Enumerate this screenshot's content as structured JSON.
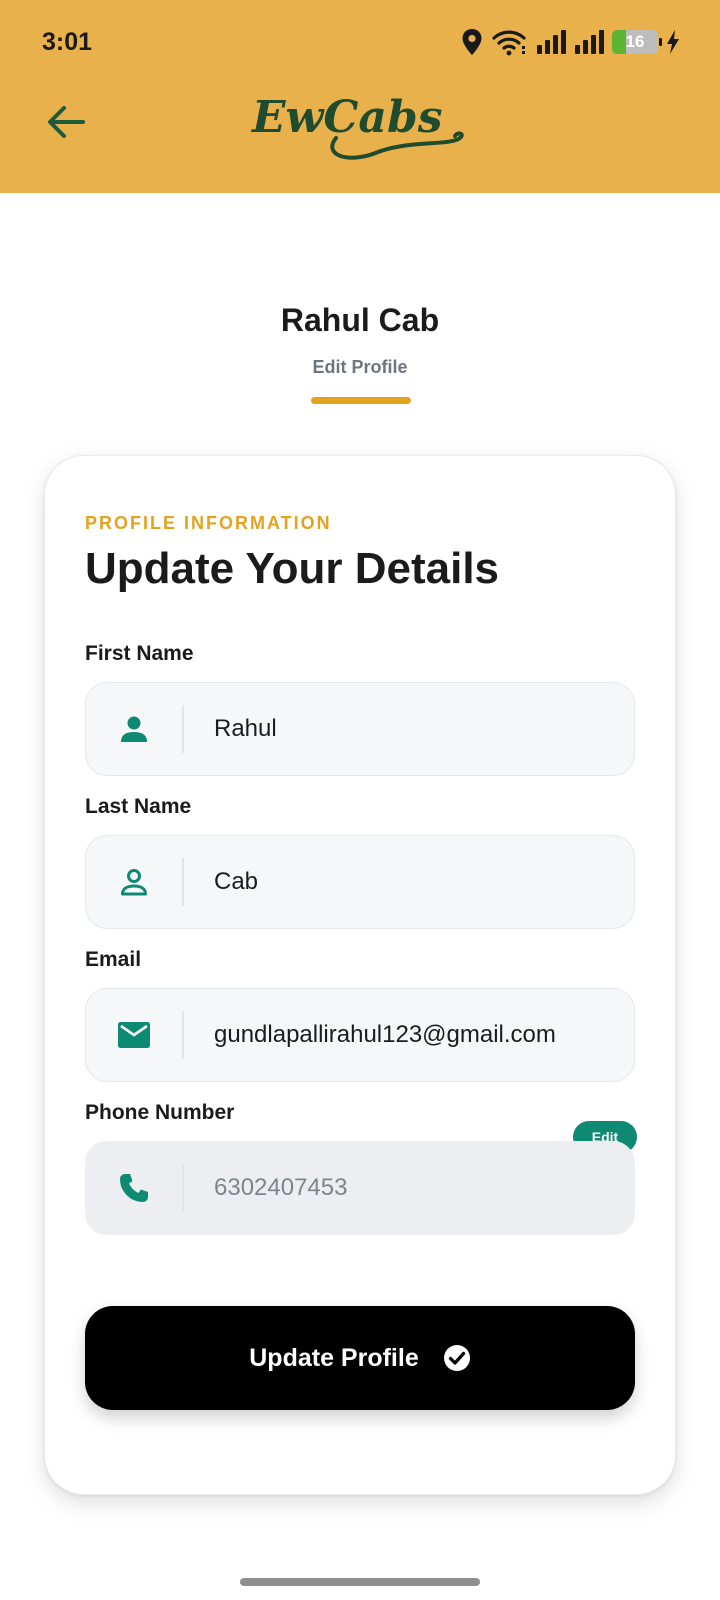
{
  "status_bar": {
    "time": "3:01",
    "battery_level": "16",
    "icons": [
      "location-icon",
      "wifi-icon",
      "signal-icon",
      "signal-icon",
      "battery-icon",
      "charging-icon"
    ]
  },
  "header": {
    "back_icon": "arrow-left-icon",
    "logo_text": "EwCabs",
    "background_color": "#E9B14C",
    "logo_color": "#1F4B2E"
  },
  "profile": {
    "name": "Rahul Cab",
    "subtitle": "Edit Profile"
  },
  "form": {
    "section_label": "PROFILE INFORMATION",
    "title": "Update Your Details",
    "first_name": {
      "label": "First Name",
      "value": "Rahul",
      "icon": "person-filled-icon"
    },
    "last_name": {
      "label": "Last Name",
      "value": "Cab",
      "icon": "person-outline-icon"
    },
    "email": {
      "label": "Email",
      "value": "gundlapallirahul123@gmail.com",
      "icon": "mail-icon"
    },
    "phone": {
      "label": "Phone Number",
      "value": "6302407453",
      "icon": "phone-icon",
      "edit_label": "Edit"
    },
    "submit_label": "Update Profile",
    "accent_color": "#E3A21F",
    "icon_color": "#0E8A73"
  }
}
